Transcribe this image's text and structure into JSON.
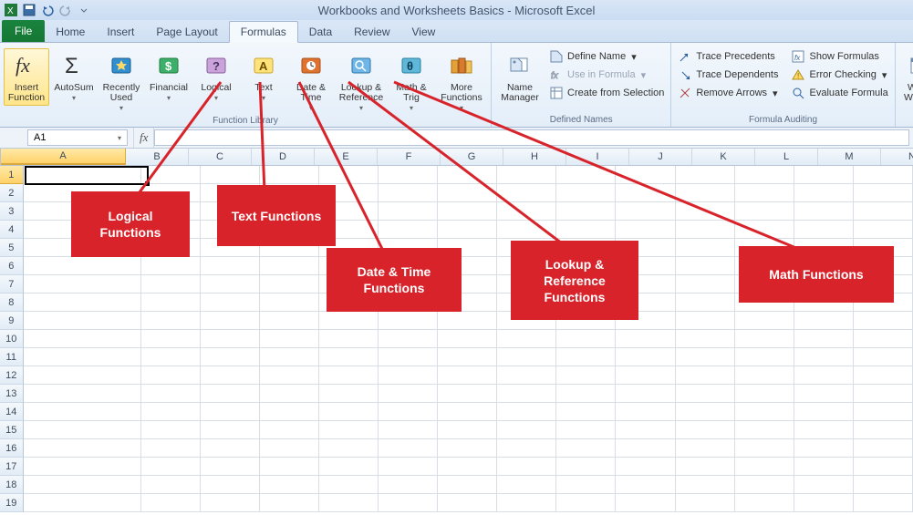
{
  "title": "Workbooks and Worksheets Basics - Microsoft Excel",
  "tabs": {
    "file": "File",
    "items": [
      "Home",
      "Insert",
      "Page Layout",
      "Formulas",
      "Data",
      "Review",
      "View"
    ],
    "active": "Formulas"
  },
  "ribbon": {
    "function_library": {
      "label": "Function Library",
      "insert_function": "Insert Function",
      "autosum": "AutoSum",
      "recently_used": "Recently Used",
      "financial": "Financial",
      "logical": "Logical",
      "text": "Text",
      "date_time": "Date & Time",
      "lookup_reference": "Lookup & Reference",
      "math_trig": "Math & Trig",
      "more_functions": "More Functions"
    },
    "defined_names": {
      "label": "Defined Names",
      "name_manager": "Name Manager",
      "define_name": "Define Name",
      "use_in_formula": "Use in Formula",
      "create_from_selection": "Create from Selection"
    },
    "formula_auditing": {
      "label": "Formula Auditing",
      "trace_precedents": "Trace Precedents",
      "trace_dependents": "Trace Dependents",
      "remove_arrows": "Remove Arrows",
      "show_formulas": "Show Formulas",
      "error_checking": "Error Checking",
      "evaluate_formula": "Evaluate Formula"
    },
    "watch_window": "Watch Window"
  },
  "namebox": "A1",
  "fx": "fx",
  "columns": [
    "A",
    "B",
    "C",
    "D",
    "E",
    "F",
    "G",
    "H",
    "I",
    "J",
    "K",
    "L",
    "M",
    "N"
  ],
  "rows": [
    "1",
    "2",
    "3",
    "4",
    "5",
    "6",
    "7",
    "8",
    "9",
    "10",
    "11",
    "12",
    "13",
    "14",
    "15",
    "16",
    "17",
    "18",
    "19"
  ],
  "selected_col": "A",
  "selected_row": "1",
  "callouts": {
    "logical": "Logical Functions",
    "text": "Text Functions",
    "date_time": "Date & Time Functions",
    "lookup": "Lookup & Reference Functions",
    "math": "Math Functions"
  }
}
